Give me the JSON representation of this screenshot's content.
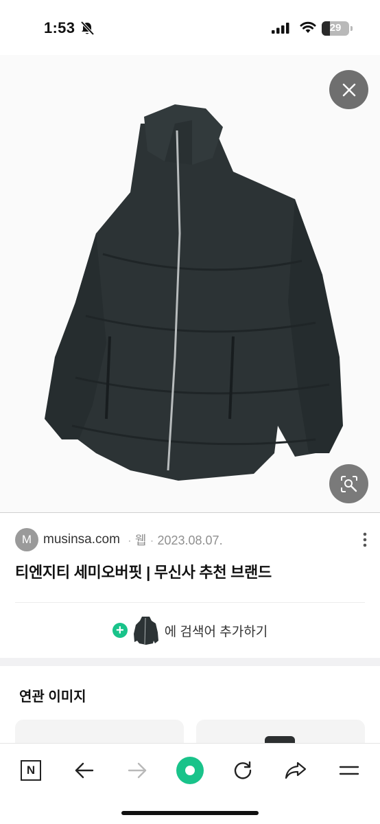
{
  "status_bar": {
    "time": "1:53",
    "battery": "29",
    "battery_level": 0.29,
    "icons": [
      "bell-slash-icon",
      "cellular-signal-icon",
      "wifi-icon",
      "battery-icon"
    ]
  },
  "viewer": {
    "close_icon": "close-icon",
    "lens_icon": "lens-search-icon"
  },
  "source": {
    "logo_letter": "M",
    "domain": "musinsa.com",
    "type": "웹",
    "date": "2023.08.07.",
    "title": "티엔지티 세미오버핏 | 무신사 추천 브랜드"
  },
  "add_keyword": {
    "label": "에 검색어 추가하기"
  },
  "related": {
    "title": "연관 이미지"
  },
  "toolbar": {
    "home_label": "N",
    "icons": [
      "home-n-icon",
      "back-icon",
      "forward-icon",
      "green-dot-icon",
      "refresh-icon",
      "share-icon",
      "menu-icon"
    ]
  },
  "colors": {
    "accent_green": "#19C38A",
    "overlay_gray": "#6F6F6F",
    "jacket": "#2C3335"
  }
}
